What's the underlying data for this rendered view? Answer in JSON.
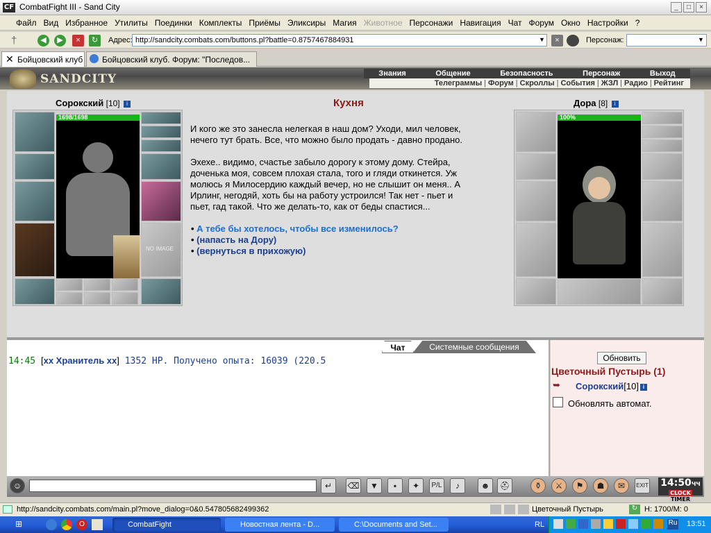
{
  "window": {
    "title": "CombatFight III - Sand City",
    "logo": "CF"
  },
  "menu": [
    "Файл",
    "Вид",
    "Избранное",
    "Утилиты",
    "Поединки",
    "Комплекты",
    "Приёмы",
    "Эликсиры",
    "Магия",
    "Животное",
    "Персонажи",
    "Навигация",
    "Чат",
    "Форум",
    "Окно",
    "Настройки",
    "?"
  ],
  "menu_disabled": "Животное",
  "address": {
    "label": "Адрес:",
    "value": "http://sandcity.combats.com/buttons.pl?battle=0.8757467884931",
    "person_label": "Персонаж:"
  },
  "tabs": [
    {
      "label": "Бойцовский клуб"
    },
    {
      "label": "Бойцовский клуб. Форум: \"Последов..."
    }
  ],
  "game_nav": {
    "logo": "SANDCITY",
    "top": [
      "Знания",
      "Общение",
      "Безопасность",
      "Персонаж",
      "Выход"
    ],
    "sub": [
      "Телеграммы",
      "Форум",
      "Скроллы",
      "События",
      "ЖЗЛ",
      "Радио",
      "Рейтинг"
    ]
  },
  "player": {
    "name": "Сорокский",
    "level": "[10]",
    "hp": "1698/1698",
    "hp_pct": 100,
    "no_image": "NO IMAGE"
  },
  "npc": {
    "name": "Дора",
    "level": "[8]",
    "hp": "100%",
    "hp_pct": 100
  },
  "room": {
    "title": "Кухня",
    "story1": [
      "И кого же это занесла нелегкая в наш дом? Уходи, мил человек,",
      "нечего тут брать. Все, что можно было продать - давно продано."
    ],
    "story2": [
      "Эхехе.. видимо, счастье забыло дорогу к этому дому. Стейра,",
      "доченька моя, совсем плохая стала, того и гляди откинется. Уж",
      "молюсь я Милосердию каждый вечер, но не слышит он меня.. А",
      "Ирлинг, негодяй, хоть бы на работу устроился! Так нет - пьет и",
      "пьет, гад такой. Что же делать-то, как от беды спастися..."
    ],
    "options": [
      "А тебе бы хотелось, чтобы все изменилось?",
      "(напасть на Дору)",
      "(вернуться в прихожую)"
    ]
  },
  "chat": {
    "tabs": [
      "Чат",
      "Системные сообщения"
    ],
    "line": {
      "time": "14:45",
      "author": "хх Хранитель хх",
      "text": "1352 НР. Получено опыта: 16039 (220.5"
    }
  },
  "side": {
    "refresh": "Обновить",
    "location": "Цветочный Пустырь (1)",
    "player": "Сорокский",
    "player_level": "[10]",
    "auto_label": "Обновлять автомат."
  },
  "clock": {
    "time": "14:50",
    "suffix": "ЧЧ",
    "labels": [
      "CLOCK",
      "TIMER"
    ]
  },
  "status": {
    "url": "http://sandcity.combats.com/main.pl?move_dialog=0&0.547805682499362",
    "location": "Цветочный Пустырь",
    "hp": "Н: 1700/М: 0"
  },
  "taskbar": {
    "tasks": [
      "CombatFight",
      "Новостная лента - D...",
      "C:\\Documents and Set..."
    ],
    "lang_left": "RL",
    "lang": "Ru",
    "time": "13:51"
  },
  "colors": {
    "accent_red": "#8b1a1a",
    "link_blue": "#1a6fd4",
    "hp_green": "#18b418",
    "taskbar": "#245edb"
  }
}
